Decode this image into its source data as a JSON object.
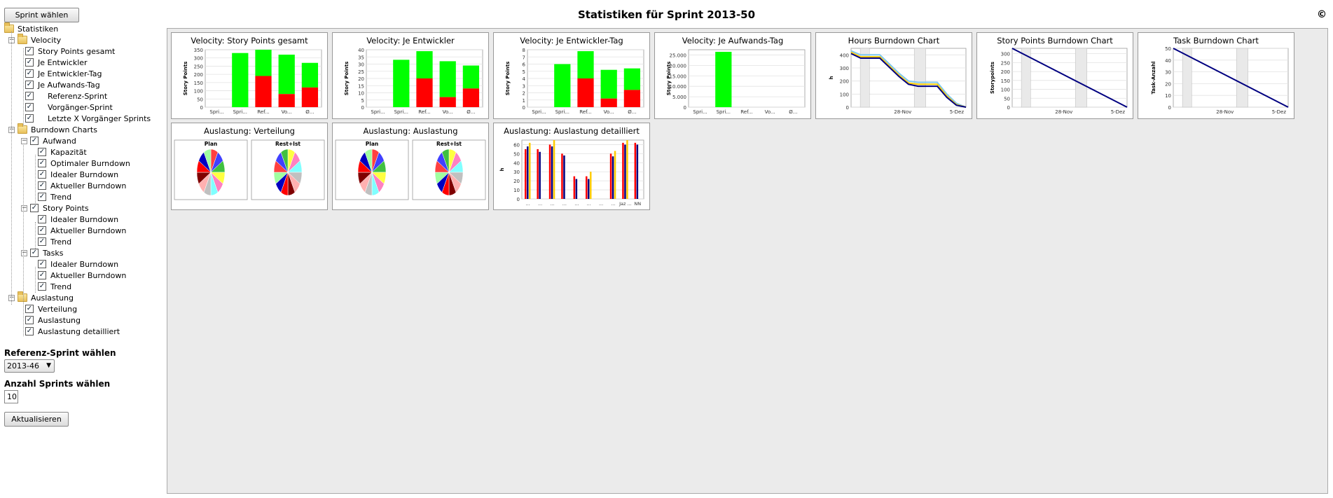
{
  "header": {
    "select_sprint_label": "Sprint wählen",
    "title": "Statistiken für Sprint 2013-50",
    "copyright_symbol": "©"
  },
  "tree": {
    "root": "Statistiken",
    "velocity": {
      "label": "Velocity",
      "items": [
        "Story Points gesamt",
        "Je Entwickler",
        "Je Entwickler-Tag",
        "Je Aufwands-Tag"
      ],
      "sub_items": [
        "Referenz-Sprint",
        "Vorgänger-Sprint",
        "Letzte X Vorgänger Sprints"
      ]
    },
    "burndown": {
      "label": "Burndown Charts",
      "aufwand": {
        "label": "Aufwand",
        "items": [
          "Kapazität",
          "Optimaler Burndown",
          "Idealer Burndown",
          "Aktueller Burndown",
          "Trend"
        ]
      },
      "story_points": {
        "label": "Story Points",
        "items": [
          "Idealer Burndown",
          "Aktueller Burndown",
          "Trend"
        ]
      },
      "tasks": {
        "label": "Tasks",
        "items": [
          "Idealer Burndown",
          "Aktueller Burndown",
          "Trend"
        ]
      }
    },
    "auslastung": {
      "label": "Auslastung",
      "items": [
        "Verteilung",
        "Auslastung",
        "Auslastung detailliert"
      ]
    },
    "checkmark": "✓"
  },
  "controls": {
    "ref_sprint_heading": "Referenz-Sprint wählen",
    "ref_sprint_value": "2013-46",
    "num_sprints_heading": "Anzahl Sprints wählen",
    "num_sprints_value": "10",
    "refresh_label": "Aktualisieren"
  },
  "colors": {
    "green": "#00ff00",
    "red": "#ff0000",
    "navy": "#000080",
    "yellow": "#ffcc00",
    "lightblue": "#7ec8f0"
  },
  "chart_data": [
    {
      "type": "bar",
      "title": "Velocity: Story Points gesamt",
      "ylabel": "Story Points",
      "categories": [
        "Spri...",
        "Spri...",
        "Ref...",
        "Vo...",
        "Ø..."
      ],
      "ylim": [
        0,
        350
      ],
      "yticks": [
        "0",
        "50",
        "100",
        "150",
        "200",
        "250",
        "300",
        "350"
      ],
      "series": [
        {
          "values": [
            0,
            0,
            190,
            80,
            120
          ]
        },
        {
          "values": [
            0,
            330,
            160,
            240,
            150
          ]
        }
      ]
    },
    {
      "type": "bar",
      "title": "Velocity: Je Entwickler",
      "ylabel": "Story Points",
      "categories": [
        "Spri...",
        "Spri...",
        "Ref...",
        "Vo...",
        "Ø..."
      ],
      "ylim": [
        0,
        40
      ],
      "yticks": [
        "0",
        "5",
        "10",
        "15",
        "20",
        "25",
        "30",
        "35",
        "40"
      ],
      "series": [
        {
          "values": [
            0,
            0,
            20,
            7,
            13
          ]
        },
        {
          "values": [
            0,
            33,
            19,
            25,
            16
          ]
        }
      ]
    },
    {
      "type": "bar",
      "title": "Velocity: Je Entwickler-Tag",
      "ylabel": "Story Points",
      "categories": [
        "Spri...",
        "Spri...",
        "Ref...",
        "Vo...",
        "Ø..."
      ],
      "ylim": [
        0,
        8
      ],
      "yticks": [
        "0",
        "1",
        "2",
        "3",
        "4",
        "5",
        "6",
        "7",
        "8"
      ],
      "series": [
        {
          "values": [
            0,
            0,
            4,
            1.2,
            2.4
          ]
        },
        {
          "values": [
            0,
            6,
            3.8,
            4,
            3
          ]
        }
      ]
    },
    {
      "type": "bar",
      "title": "Velocity: Je Aufwands-Tag",
      "ylabel": "Story Points",
      "categories": [
        "Spri...",
        "Spri...",
        "Ref...",
        "Vo...",
        "Ø..."
      ],
      "ylim": [
        0,
        27500
      ],
      "yticks": [
        "0",
        "5.000",
        "10.000",
        "15.000",
        "20.000",
        "25.000"
      ],
      "series": [
        {
          "values": [
            0,
            0,
            0,
            0,
            0
          ]
        },
        {
          "values": [
            0,
            26500,
            0,
            0,
            0
          ]
        }
      ]
    },
    {
      "type": "line",
      "title": "Hours Burndown Chart",
      "ylabel": "h",
      "xticks": [
        "28-Nov",
        "5-Dez"
      ],
      "ylim": [
        0,
        450
      ],
      "yticks": [
        "0",
        "100",
        "200",
        "300",
        "400"
      ],
      "series": [
        {
          "values": [
            430,
            400,
            400,
            400,
            330,
            260,
            200,
            190,
            190,
            190,
            100,
            30,
            0
          ]
        },
        {
          "values": [
            420,
            385,
            385,
            385,
            315,
            245,
            185,
            175,
            175,
            175,
            85,
            20,
            0
          ]
        },
        {
          "values": [
            410,
            375,
            375,
            375,
            305,
            235,
            175,
            160,
            160,
            160,
            75,
            15,
            0
          ]
        }
      ]
    },
    {
      "type": "line",
      "title": "Story Points Burndown Chart",
      "ylabel": "Storypoints",
      "xticks": [
        "28-Nov",
        "5-Dez"
      ],
      "ylim": [
        0,
        330
      ],
      "yticks": [
        "0",
        "50",
        "100",
        "150",
        "200",
        "250",
        "300"
      ],
      "series": [
        {
          "values": [
            330,
            0
          ]
        }
      ]
    },
    {
      "type": "line",
      "title": "Task Burndown Chart",
      "ylabel": "Task-Anzahl",
      "xticks": [
        "28-Nov",
        "5-Dez"
      ],
      "ylim": [
        0,
        50
      ],
      "yticks": [
        "0",
        "10",
        "20",
        "30",
        "40",
        "50"
      ],
      "series": [
        {
          "values": [
            50,
            0
          ]
        }
      ]
    },
    {
      "type": "pie",
      "title": "Auslastung: Verteilung",
      "subtitles": [
        "Plan",
        "Rest+Ist"
      ]
    },
    {
      "type": "pie",
      "title": "Auslastung: Auslastung",
      "subtitles": [
        "Plan",
        "Rest+Ist"
      ]
    },
    {
      "type": "bar",
      "title": "Auslastung: Auslastung detailliert",
      "ylabel": "h",
      "categories": [
        "...",
        "...",
        "...",
        "...",
        "...",
        "...",
        "...",
        "...",
        "Jaz ...",
        "NN"
      ],
      "ylim": [
        0,
        65
      ],
      "yticks": [
        "0",
        "10",
        "20",
        "30",
        "40",
        "50",
        "60"
      ],
      "series": [
        {
          "values": [
            55,
            55,
            60,
            50,
            25,
            25,
            0,
            50,
            62,
            62
          ]
        },
        {
          "values": [
            58,
            52,
            58,
            48,
            22,
            22,
            0,
            47,
            60,
            60
          ]
        },
        {
          "values": [
            62,
            0,
            65,
            0,
            0,
            30,
            0,
            53,
            65,
            0
          ]
        }
      ]
    }
  ]
}
